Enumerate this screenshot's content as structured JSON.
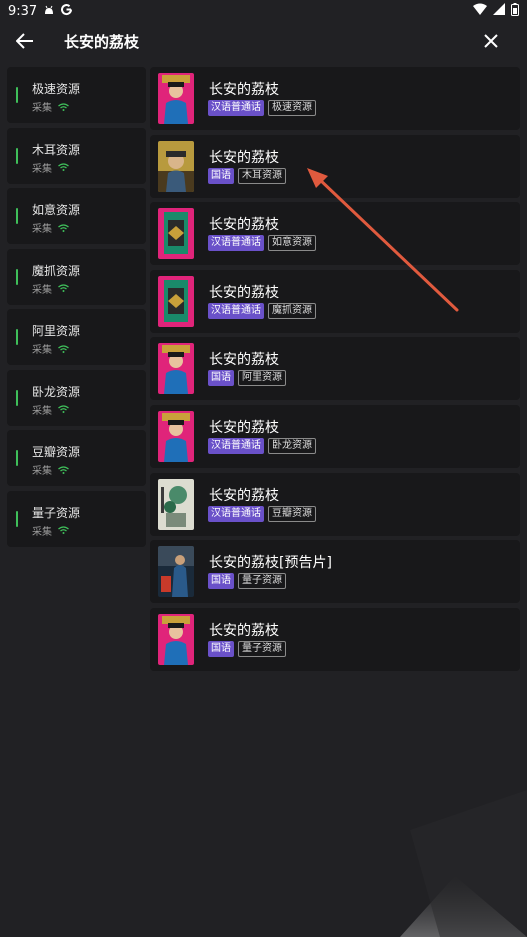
{
  "status_bar": {
    "time": "9:37"
  },
  "app_bar": {
    "title": "长安的荔枝"
  },
  "colors": {
    "accent": "#6a51c9",
    "indicator": "#3fbf5a",
    "arrow": "#e05a3e"
  },
  "sources": [
    {
      "name": "极速资源",
      "sub": "采集"
    },
    {
      "name": "木耳资源",
      "sub": "采集"
    },
    {
      "name": "如意资源",
      "sub": "采集"
    },
    {
      "name": "魔抓资源",
      "sub": "采集"
    },
    {
      "name": "阿里资源",
      "sub": "采集"
    },
    {
      "name": "卧龙资源",
      "sub": "采集"
    },
    {
      "name": "豆瓣资源",
      "sub": "采集"
    },
    {
      "name": "量子资源",
      "sub": "采集"
    }
  ],
  "results": [
    {
      "title": "长安的荔枝",
      "lang": "汉语普通话",
      "source": "极速资源"
    },
    {
      "title": "长安的荔枝",
      "lang": "国语",
      "source": "木耳资源"
    },
    {
      "title": "长安的荔枝",
      "lang": "汉语普通话",
      "source": "如意资源"
    },
    {
      "title": "长安的荔枝",
      "lang": "汉语普通话",
      "source": "魔抓资源"
    },
    {
      "title": "长安的荔枝",
      "lang": "国语",
      "source": "阿里资源"
    },
    {
      "title": "长安的荔枝",
      "lang": "汉语普通话",
      "source": "卧龙资源"
    },
    {
      "title": "长安的荔枝",
      "lang": "汉语普通话",
      "source": "豆瓣资源"
    },
    {
      "title": "长安的荔枝[预告片]",
      "lang": "国语",
      "source": "量子资源"
    },
    {
      "title": "长安的荔枝",
      "lang": "国语",
      "source": "量子资源"
    }
  ]
}
